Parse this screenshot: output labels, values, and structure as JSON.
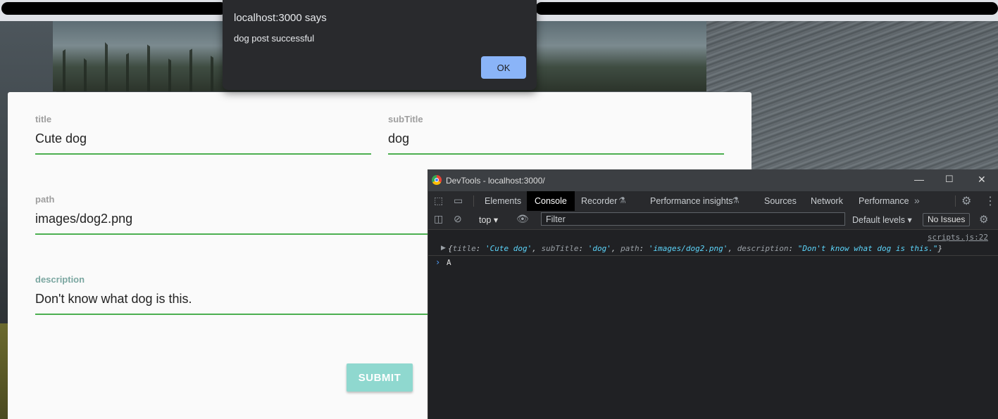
{
  "dialog": {
    "title": "localhost:3000 says",
    "message": "dog post successful",
    "ok_label": "OK"
  },
  "form": {
    "title": {
      "label": "title",
      "value": "Cute dog"
    },
    "subtitle": {
      "label": "subTitle",
      "value": "dog"
    },
    "path": {
      "label": "path",
      "value": "images/dog2.png"
    },
    "description": {
      "label": "description",
      "value": "Don't know what dog is this."
    },
    "submit_label": "SUBMIT"
  },
  "devtools": {
    "window_title": "DevTools - localhost:3000/",
    "tabs": [
      "Elements",
      "Console",
      "Recorder",
      "Performance insights",
      "Sources",
      "Network",
      "Performance"
    ],
    "active_tab": "Console",
    "context": "top",
    "filter_placeholder": "Filter",
    "levels_label": "Default levels",
    "issues_label": "No Issues",
    "log": {
      "source": "scripts.js:22",
      "open": "{",
      "title_key": "title",
      "title_val": "'Cute dog'",
      "subtitle_key": "subTitle",
      "subtitle_val": "'dog'",
      "path_key": "path",
      "path_val": "'images/dog2.png'",
      "desc_key": "description",
      "desc_val": "\"Don't know what dog is this.\"",
      "close": "}"
    },
    "prompt_input": "A"
  },
  "colors": {
    "underline": "#4caf50",
    "submit_bg": "#8fd8cf",
    "ok_button": "#8ab4f8",
    "devtools_bg": "#202124",
    "string_value": "#5cd5fb"
  },
  "icons": [
    "inspect-icon",
    "device-toolbar-icon",
    "flask-icon",
    "more-tabs-icon",
    "settings-icon",
    "kebab-menu-icon",
    "sidebar-toggle-icon",
    "clear-console-icon",
    "eye-icon",
    "chrome-logo-icon"
  ]
}
